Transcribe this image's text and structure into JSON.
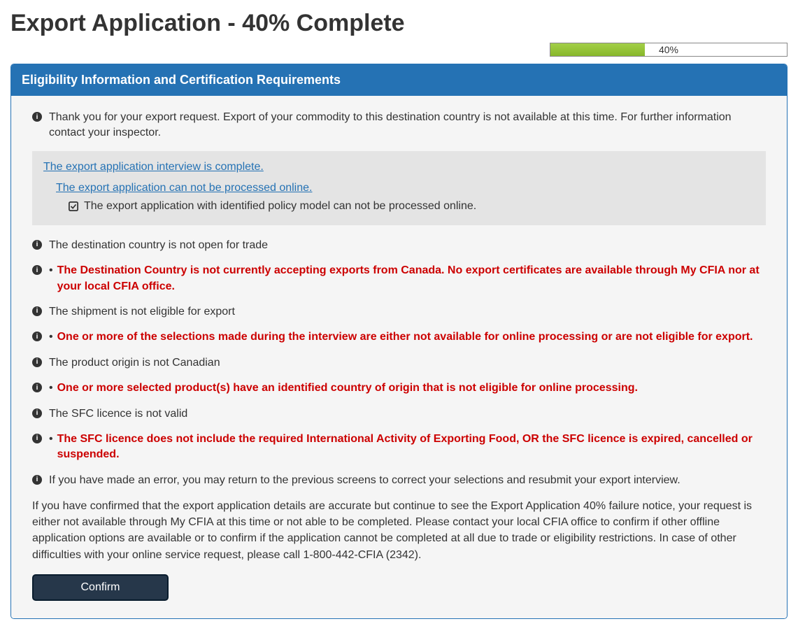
{
  "page_title": "Export Application - 40% Complete",
  "progress": {
    "label": "40%",
    "percent": 40
  },
  "panel": {
    "header": "Eligibility Information and Certification Requirements",
    "intro": "Thank you for your export request. Export of your commodity to this destination country is not available at this time. For further information contact your inspector.",
    "box": {
      "l1": "The export application interview is complete.",
      "l2": "The export application can not be processed online.",
      "l3": "The export application with identified policy model can not be processed online."
    },
    "items": [
      {
        "kind": "plain",
        "text": "The destination country is not open for trade"
      },
      {
        "kind": "red",
        "text": "The Destination Country is not currently accepting exports from Canada. No export certificates are available through My CFIA nor at your local CFIA office."
      },
      {
        "kind": "plain",
        "text": "The shipment is not eligible for export"
      },
      {
        "kind": "red",
        "text": "One or more of the selections made during the interview are either not available for online processing or are not eligible for export."
      },
      {
        "kind": "plain",
        "text": "The product origin is not Canadian"
      },
      {
        "kind": "red",
        "text": "One or more selected product(s) have an identified country of origin that is not eligible for online processing."
      },
      {
        "kind": "plain",
        "text": "The SFC licence is not valid"
      },
      {
        "kind": "red",
        "text": "The SFC licence does not include the required International Activity of Exporting Food, OR the SFC licence is expired, cancelled or suspended."
      },
      {
        "kind": "plain",
        "text": "If you have made an error, you may return to the previous screens to correct your selections and resubmit your export interview."
      }
    ],
    "footer": "If you have confirmed that the export application details are accurate but continue to see the Export Application 40% failure notice, your request is either not available through My CFIA at this time or not able to be completed. Please contact your local CFIA office to confirm if other offline application options are available or to confirm if the application cannot be completed at all due to trade or eligibility restrictions. In case of other difficulties with your online service request, please call 1-800-442-CFIA (2342).",
    "confirm_label": "Confirm"
  }
}
